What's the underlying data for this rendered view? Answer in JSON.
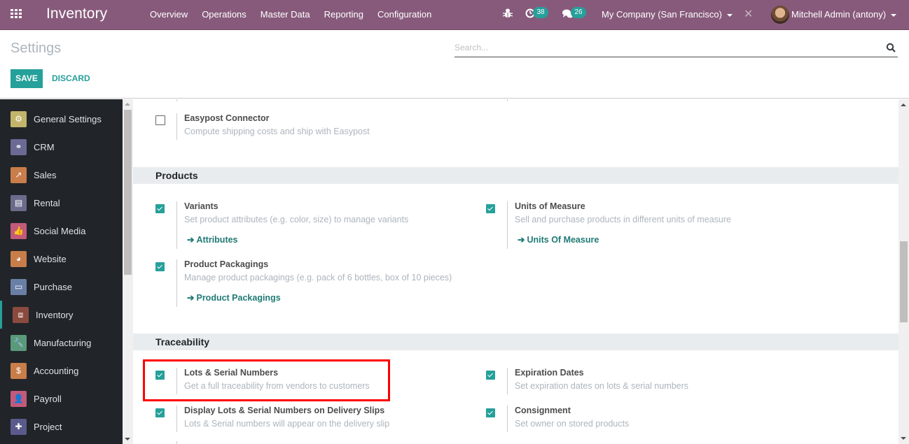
{
  "navbar": {
    "app_title": "Inventory",
    "menu": [
      "Overview",
      "Operations",
      "Master Data",
      "Reporting",
      "Configuration"
    ],
    "activity_count": "38",
    "message_count": "26",
    "company": "My Company (San Francisco)",
    "user": "Mitchell Admin (antony)"
  },
  "control": {
    "breadcrumb": "Settings",
    "save_label": "SAVE",
    "discard_label": "DISCARD",
    "search_placeholder": "Search..."
  },
  "sidebar": {
    "items": [
      {
        "label": "General Settings",
        "icon": "gear-icon",
        "color": "#c2b46a",
        "glyph": "⚙"
      },
      {
        "label": "CRM",
        "icon": "handshake-icon",
        "color": "#6a6a95",
        "glyph": "⚭"
      },
      {
        "label": "Sales",
        "icon": "chart-trend-icon",
        "color": "#c97d4a",
        "glyph": "↗"
      },
      {
        "label": "Rental",
        "icon": "calendar-grid-icon",
        "color": "#6b6b8c",
        "glyph": "▤"
      },
      {
        "label": "Social Media",
        "icon": "thumbs-up-icon",
        "color": "#c25a7a",
        "glyph": "👍"
      },
      {
        "label": "Website",
        "icon": "globe-icon",
        "color": "#c97d4a",
        "glyph": "◕"
      },
      {
        "label": "Purchase",
        "icon": "credit-card-icon",
        "color": "#6a7fa6",
        "glyph": "▭"
      },
      {
        "label": "Inventory",
        "icon": "box-icon",
        "color": "#8b4a3e",
        "glyph": "⧈",
        "active": true
      },
      {
        "label": "Manufacturing",
        "icon": "wrench-icon",
        "color": "#5a9a7a",
        "glyph": "🔧"
      },
      {
        "label": "Accounting",
        "icon": "invoice-dollar-icon",
        "color": "#c97d4a",
        "glyph": "$"
      },
      {
        "label": "Payroll",
        "icon": "employee-payslip-icon",
        "color": "#c25a7a",
        "glyph": "👤"
      },
      {
        "label": "Project",
        "icon": "puzzle-icon",
        "color": "#5a5a8c",
        "glyph": "✚"
      }
    ]
  },
  "content": {
    "shipping": {
      "easypost": {
        "title": "Easypost Connector",
        "desc": "Compute shipping costs and ship with Easypost",
        "checked": false
      }
    },
    "products": {
      "title": "Products",
      "variants": {
        "title": "Variants",
        "desc": "Set product attributes (e.g. color, size) to manage variants",
        "link": "Attributes",
        "checked": true
      },
      "uom": {
        "title": "Units of Measure",
        "desc": "Sell and purchase products in different units of measure",
        "link": "Units Of Measure",
        "checked": true
      },
      "packagings": {
        "title": "Product Packagings",
        "desc": "Manage product packagings (e.g. pack of 6 bottles, box of 10 pieces)",
        "link": "Product Packagings",
        "checked": true
      }
    },
    "traceability": {
      "title": "Traceability",
      "lots": {
        "title": "Lots & Serial Numbers",
        "desc": "Get a full traceability from vendors to customers",
        "checked": true
      },
      "expiration": {
        "title": "Expiration Dates",
        "desc": "Set expiration dates on lots & serial numbers",
        "checked": true
      },
      "delivery_slips": {
        "title": "Display Lots & Serial Numbers on Delivery Slips",
        "desc": "Lots & Serial numbers will appear on the delivery slip",
        "checked": true
      },
      "consignment": {
        "title": "Consignment",
        "desc": "Set owner on stored products",
        "checked": true
      }
    }
  },
  "colors": {
    "navbar": "#875a7b",
    "accent": "#26a09a",
    "sidebar": "#212529",
    "highlight": "#ff0000"
  }
}
